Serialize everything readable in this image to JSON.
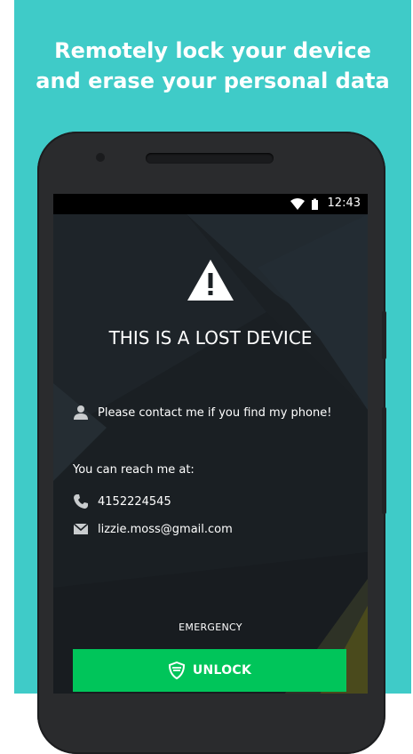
{
  "headline": {
    "line1": "Remotely lock your device",
    "line2": "and erase your personal data"
  },
  "status_bar": {
    "time": "12:43",
    "icons": [
      "wifi-icon",
      "battery-icon"
    ]
  },
  "lost_screen": {
    "title": "THIS IS A LOST DEVICE",
    "message": "Please contact me if you find my phone!",
    "reach_label": "You can reach me at:",
    "phone": "4152224545",
    "email": "lizzie.moss@gmail.com",
    "emergency_label": "EMERGENCY",
    "unlock_label": "UNLOCK"
  },
  "colors": {
    "background": "#3fcbc8",
    "unlock_button": "#00c55a",
    "screen": "#1b2024"
  }
}
